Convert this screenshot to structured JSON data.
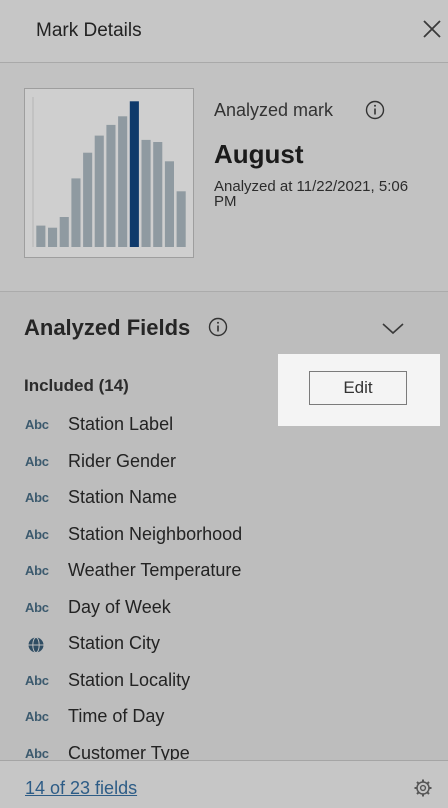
{
  "header": {
    "title": "Mark Details"
  },
  "mark": {
    "label": "Analyzed mark",
    "name": "August",
    "analyzed_at": "Analyzed at 11/22/2021, 5:06 PM"
  },
  "thumbnail_chart": {
    "values": [
      10,
      9,
      14,
      32,
      44,
      52,
      57,
      61,
      68,
      50,
      49,
      40,
      26
    ],
    "highlight_index": 8,
    "bar_color": "#8f9aa1",
    "highlight_color": "#0f3a6b"
  },
  "fields": {
    "title": "Analyzed Fields",
    "included_label": "Included (14)",
    "edit_label": "Edit",
    "items": [
      {
        "type_icon": "Abc",
        "label": "Station Label"
      },
      {
        "type_icon": "Abc",
        "label": "Rider Gender"
      },
      {
        "type_icon": "Abc",
        "label": "Station Name"
      },
      {
        "type_icon": "Abc",
        "label": "Station Neighborhood"
      },
      {
        "type_icon": "Abc",
        "label": "Weather Temperature"
      },
      {
        "type_icon": "Abc",
        "label": "Day of Week"
      },
      {
        "type_icon": "globe",
        "label": "Station City"
      },
      {
        "type_icon": "Abc",
        "label": "Station Locality"
      },
      {
        "type_icon": "Abc",
        "label": "Time of Day"
      },
      {
        "type_icon": "Abc",
        "label": "Customer Type"
      }
    ]
  },
  "footer": {
    "link_label": "14 of 23 fields"
  }
}
